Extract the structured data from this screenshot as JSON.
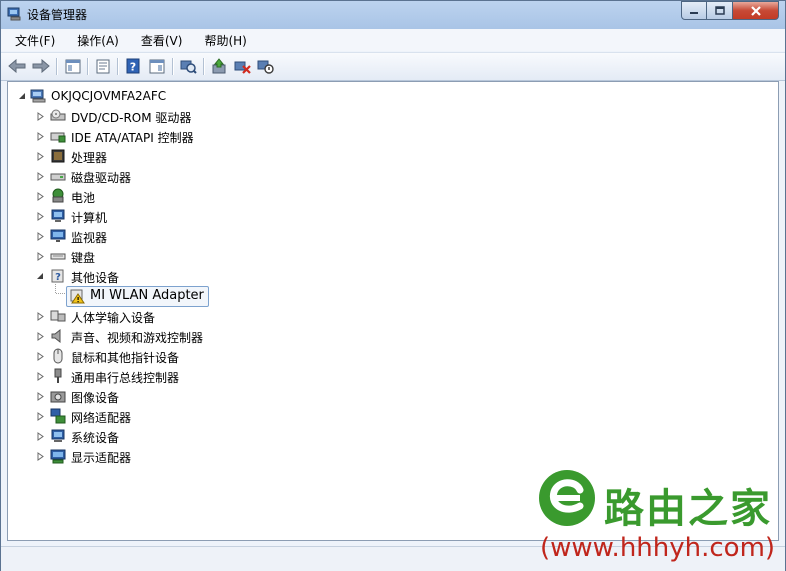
{
  "window": {
    "title": "设备管理器"
  },
  "menu": [
    {
      "label": "文件(F)"
    },
    {
      "label": "操作(A)"
    },
    {
      "label": "查看(V)"
    },
    {
      "label": "帮助(H)"
    }
  ],
  "toolbar": {
    "icons": [
      "back-arrow-icon",
      "forward-arrow-icon",
      "show-hide-console-tree-icon",
      "properties-icon",
      "help-icon",
      "action-pane-icon",
      "scan-hardware-changes-icon",
      "update-driver-icon",
      "uninstall-device-icon",
      "disable-device-icon"
    ]
  },
  "tree": {
    "root": "OKJQCJOVMFA2AFC",
    "items": [
      {
        "label": "DVD/CD-ROM 驱动器"
      },
      {
        "label": "IDE ATA/ATAPI 控制器"
      },
      {
        "label": "处理器"
      },
      {
        "label": "磁盘驱动器"
      },
      {
        "label": "电池"
      },
      {
        "label": "计算机"
      },
      {
        "label": "监视器"
      },
      {
        "label": "键盘"
      },
      {
        "label": "其他设备"
      },
      {
        "label": "MI WLAN Adapter"
      },
      {
        "label": "人体学输入设备"
      },
      {
        "label": "声音、视频和游戏控制器"
      },
      {
        "label": "鼠标和其他指针设备"
      },
      {
        "label": "通用串行总线控制器"
      },
      {
        "label": "图像设备"
      },
      {
        "label": "网络适配器"
      },
      {
        "label": "系统设备"
      },
      {
        "label": "显示适配器"
      }
    ]
  },
  "watermark": {
    "brand": "路由之家",
    "url": "(www.hhhyh.com)"
  },
  "colors": {
    "accent": "#3a9a2e",
    "selection_border": "#7da2ce"
  }
}
